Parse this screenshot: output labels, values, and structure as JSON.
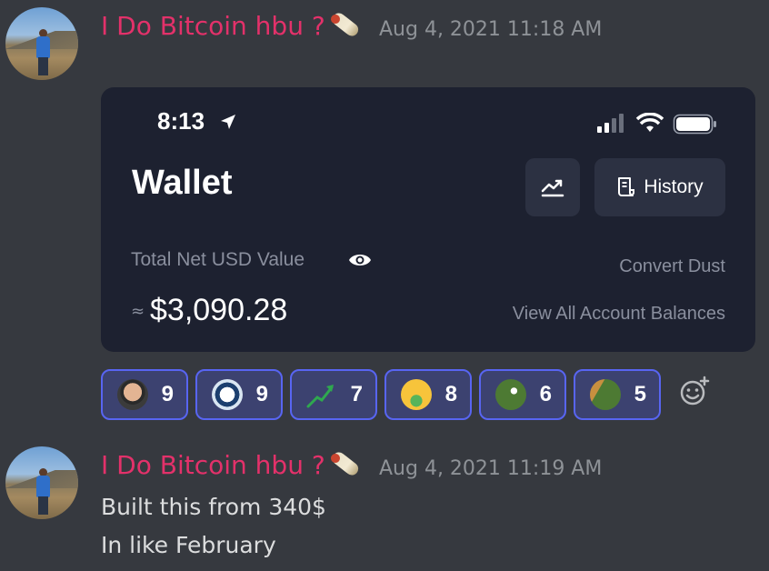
{
  "messages": [
    {
      "author": "I Do Bitcoin hbu ?",
      "timestamp": "Aug 4, 2021 11:18 AM",
      "attachment": {
        "status_time": "8:13",
        "title": "Wallet",
        "history_label": "History",
        "net_value_label": "Total Net USD Value",
        "approx_symbol": "≈",
        "net_value": "$3,090.28",
        "convert_dust": "Convert Dust",
        "view_all": "View All Account Balances"
      },
      "reactions": [
        {
          "icon": "elon-face",
          "count": "9"
        },
        {
          "icon": "coin-logo",
          "count": "9"
        },
        {
          "icon": "stonks-arrow",
          "count": "7"
        },
        {
          "icon": "money-mouth-face",
          "count": "8"
        },
        {
          "icon": "pepe-frog",
          "count": "6"
        },
        {
          "icon": "pepe-baguette",
          "count": "5"
        }
      ]
    },
    {
      "author": "I Do Bitcoin hbu ?",
      "timestamp": "Aug 4, 2021 11:19 AM",
      "lines": [
        "Built this from 340$",
        "In like February"
      ]
    }
  ],
  "colors": {
    "background": "#36393f",
    "author": "#e3316a",
    "timestamp": "#8e9297",
    "card": "#1d2130",
    "reaction_border": "#5865f2"
  }
}
